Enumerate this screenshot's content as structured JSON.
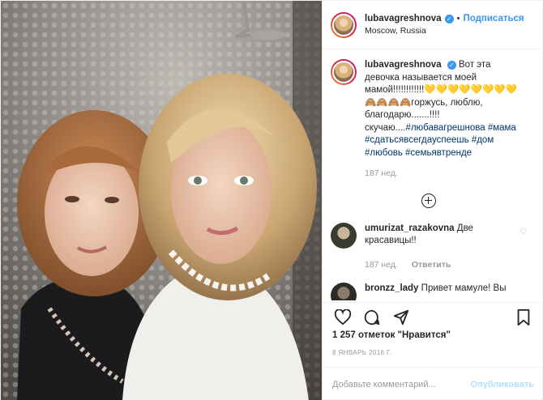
{
  "header": {
    "username": "lubavagreshnova",
    "follow_label": "Подписаться",
    "location": "Moscow, Russia"
  },
  "caption": {
    "username": "lubavagreshnova",
    "text_1": "Вот эта девочка называется моей мамой!!!!!!!!!!!!💛💛💛💛💛💛💛💛🙈🙈🙈🙈",
    "text_2": "горжусь, люблю, благодарю.......!!!!скучаю....",
    "tags": [
      "#любавагрешнова",
      "#мама",
      "#сдатьсявсегдауспеешь",
      "#дом",
      "#любовь",
      "#семьявтренде"
    ],
    "time": "187 нед."
  },
  "comments": [
    {
      "username": "umurizat_razakovna",
      "text": "Две красавицы!!",
      "time": "187 нед.",
      "reply_label": "Ответить"
    },
    {
      "username": "bronzz_lady",
      "text": "Привет мамуле! Вы",
      "time": "",
      "reply_label": ""
    }
  ],
  "likes": "1 257 отметок \"Нравится\"",
  "date": "8 ЯНВАРЬ 2016 Г.",
  "add_comment": {
    "placeholder": "Добавьте комментарий...",
    "publish_label": "Опубликовать"
  },
  "icons": [
    "heart-icon",
    "comment-icon",
    "share-icon",
    "bookmark-icon",
    "verified-icon",
    "load-more-icon"
  ],
  "colors": {
    "link": "#3897f0",
    "hashtag": "#003569",
    "muted": "#999999",
    "publish_disabled": "#b2dffc"
  }
}
